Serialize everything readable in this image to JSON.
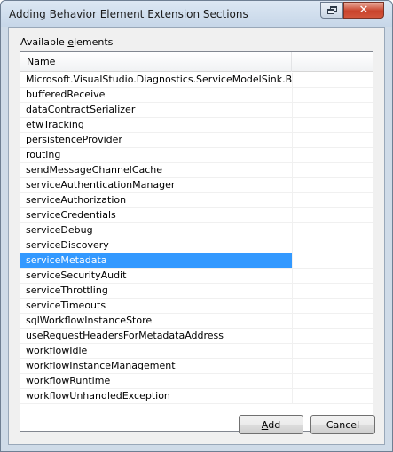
{
  "window": {
    "title": "Adding Behavior Element Extension Sections",
    "restore_icon": "restore-icon",
    "close_icon": "close-icon",
    "close_glyph": "✕"
  },
  "list": {
    "label_prefix": "Available ",
    "label_mnemonic": "e",
    "label_suffix": "lements",
    "column_header": "Name",
    "selected_index": 15,
    "selection_color": "#3399ff",
    "items": [
      "Microsoft.VisualStudio.Diagnostics.ServiceModelSink.Behavior",
      "bufferedReceive",
      "dataContractSerializer",
      "etwTracking",
      "persistenceProvider",
      "routing",
      "sendMessageChannelCache",
      "serviceAuthenticationManager",
      "serviceAuthorization",
      "serviceCredentials",
      "serviceDebug",
      "serviceDiscovery",
      "serviceMetadata",
      "serviceSecurityAudit",
      "serviceThrottling",
      "serviceTimeouts",
      "sqlWorkflowInstanceStore",
      "useRequestHeadersForMetadataAddress",
      "workflowIdle",
      "workflowInstanceManagement",
      "workflowRuntime",
      "workflowUnhandledException"
    ]
  },
  "buttons": {
    "add_mnemonic": "A",
    "add_rest": "dd",
    "cancel": "Cancel"
  }
}
